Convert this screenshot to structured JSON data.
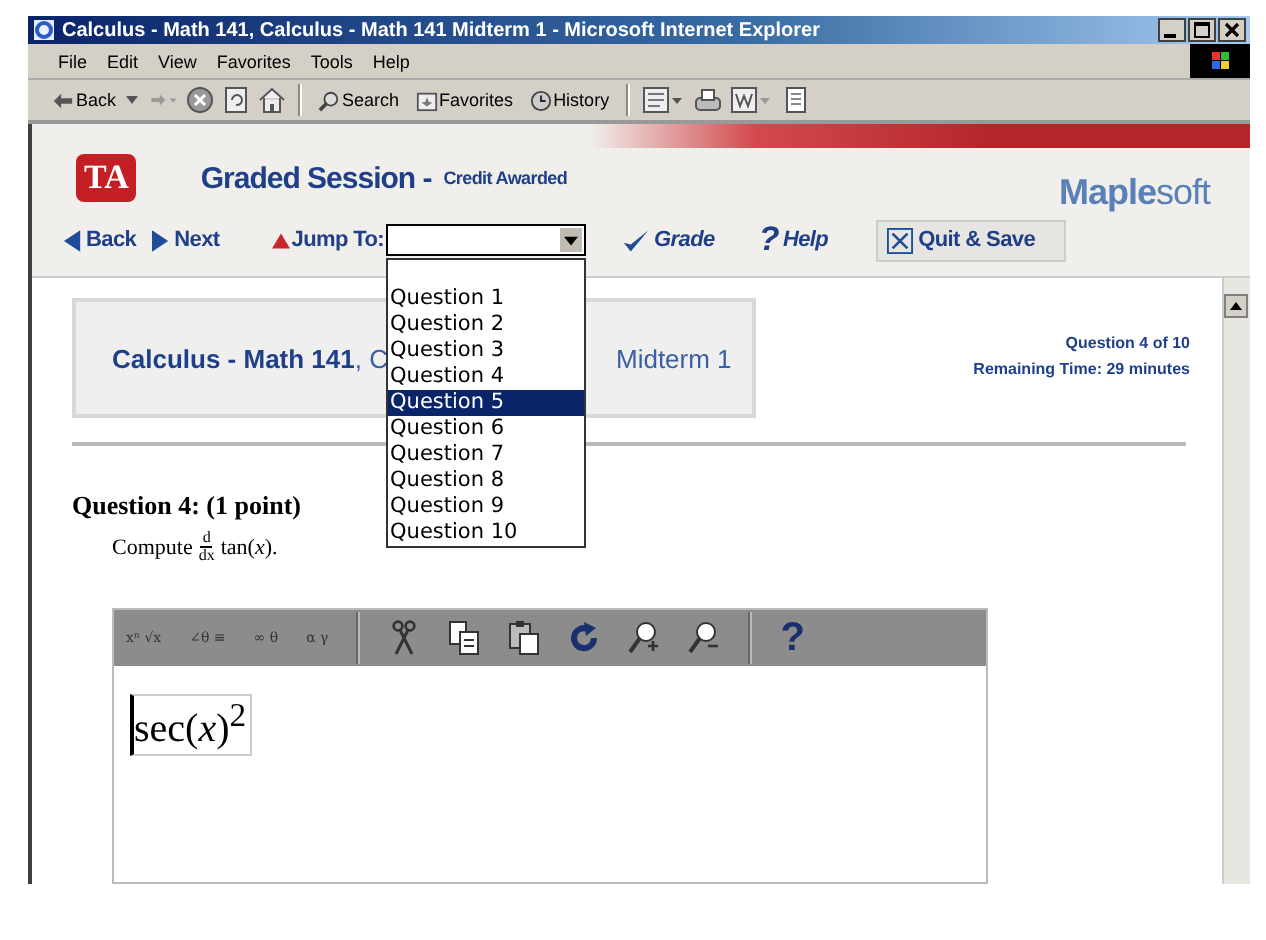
{
  "window": {
    "title": "Calculus - Math 141, Calculus - Math 141 Midterm 1 - Microsoft Internet Explorer"
  },
  "menu": [
    "File",
    "Edit",
    "View",
    "Favorites",
    "Tools",
    "Help"
  ],
  "toolbar": {
    "back": "Back",
    "search": "Search",
    "favorites": "Favorites",
    "history": "History"
  },
  "header": {
    "logo": "TA",
    "title": "Graded Session -",
    "status": "Credit Awarded",
    "brand": "**Maple**soft"
  },
  "nav": [
    {
      "kind": "back",
      "label": "Back"
    },
    {
      "kind": "next",
      "label": "Next"
    },
    {
      "kind": "jump",
      "label": "Jump To:"
    },
    {
      "kind": "grade",
      "label": "Grade"
    },
    {
      "kind": "help",
      "glyph": "?",
      "label": "Help"
    },
    {
      "kind": "quit",
      "label": "Quit & Save"
    }
  ],
  "jump_select": {
    "expanded": true,
    "options": [
      {
        "label": "Question 1",
        "selected": false
      },
      {
        "label": "Question 2",
        "selected": false
      },
      {
        "label": "Question 3",
        "selected": false
      },
      {
        "label": "Question 4",
        "selected": false
      },
      {
        "label": "Question 5",
        "selected": true
      },
      {
        "label": "Question 6",
        "selected": false
      },
      {
        "label": "Question 7",
        "selected": false
      },
      {
        "label": "Question 8",
        "selected": false
      },
      {
        "label": "Question 9",
        "selected": false
      },
      {
        "label": "Question 10",
        "selected": false
      }
    ]
  },
  "course_box": {
    "name": "Calculus - Math 141",
    "visible_parts": [
      ", C",
      "Midterm 1"
    ]
  },
  "progress": {
    "question": "Question 4 of 10",
    "time": "Remaining Time: 29 minutes"
  },
  "question": {
    "heading": "Question 4: (1 point)",
    "prompt": "Compute",
    "numerator": "d",
    "denominator": "dx",
    "expression": "tan(*x*)."
  },
  "editor": {
    "palettes": [
      "xⁿ √x",
      "∠θ ≡",
      "∞ θ",
      "α γ"
    ],
    "help": "?",
    "answer": "sec(*x*)$^{2}$"
  }
}
